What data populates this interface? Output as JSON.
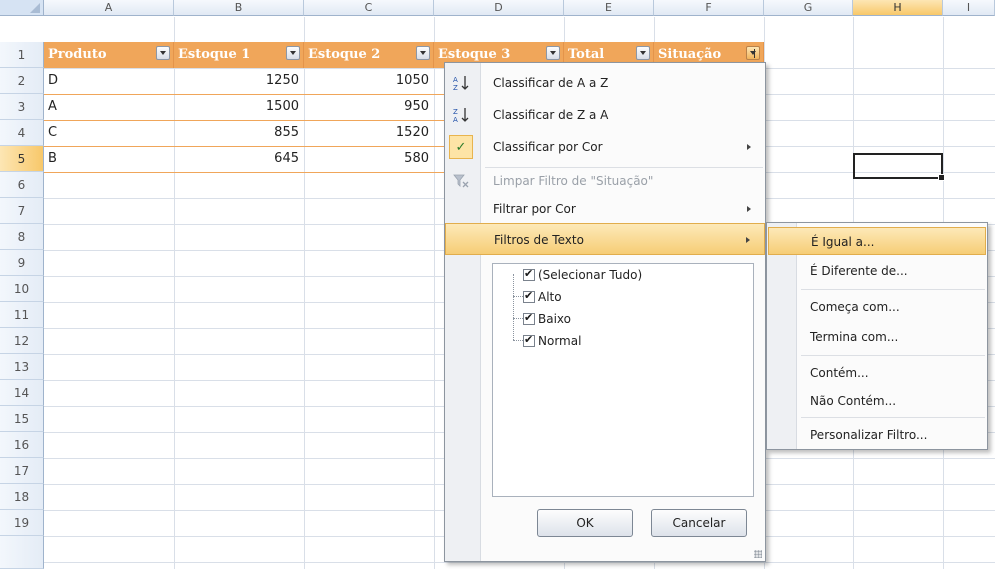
{
  "columns": [
    "A",
    "B",
    "C",
    "D",
    "E",
    "F",
    "G",
    "H",
    "I"
  ],
  "rows": [
    "1",
    "2",
    "3",
    "4",
    "5",
    "6",
    "7",
    "8",
    "9",
    "10",
    "11",
    "12",
    "13",
    "14",
    "15",
    "16",
    "17",
    "18",
    "19"
  ],
  "table": {
    "headers": [
      "Produto",
      "Estoque 1",
      "Estoque 2",
      "Estoque 3",
      "Total",
      "Situação"
    ],
    "data": [
      {
        "produto": "D",
        "estoque1": "1250",
        "estoque2": "1050"
      },
      {
        "produto": "A",
        "estoque1": "1500",
        "estoque2": "950"
      },
      {
        "produto": "C",
        "estoque1": "855",
        "estoque2": "1520"
      },
      {
        "produto": "B",
        "estoque1": "645",
        "estoque2": "580"
      }
    ]
  },
  "filter_menu": {
    "sort_az": "Classificar de A a Z",
    "sort_za": "Classificar de Z a A",
    "sort_color": "Classificar por Cor",
    "clear_filter": "Limpar Filtro de \"Situação\"",
    "filter_color": "Filtrar por Cor",
    "text_filters": "Filtros de Texto",
    "values": [
      "(Selecionar Tudo)",
      "Alto",
      "Baixo",
      "Normal"
    ],
    "ok": "OK",
    "cancel": "Cancelar"
  },
  "text_filter_submenu": [
    "É Igual a...",
    "É Diferente de...",
    "Começa com...",
    "Termina com...",
    "Contém...",
    "Não Contém...",
    "Personalizar Filtro..."
  ],
  "colors": {
    "header_fill": "#f0a65a",
    "highlight": "#f6cd76",
    "grid": "#d9dfe8"
  }
}
